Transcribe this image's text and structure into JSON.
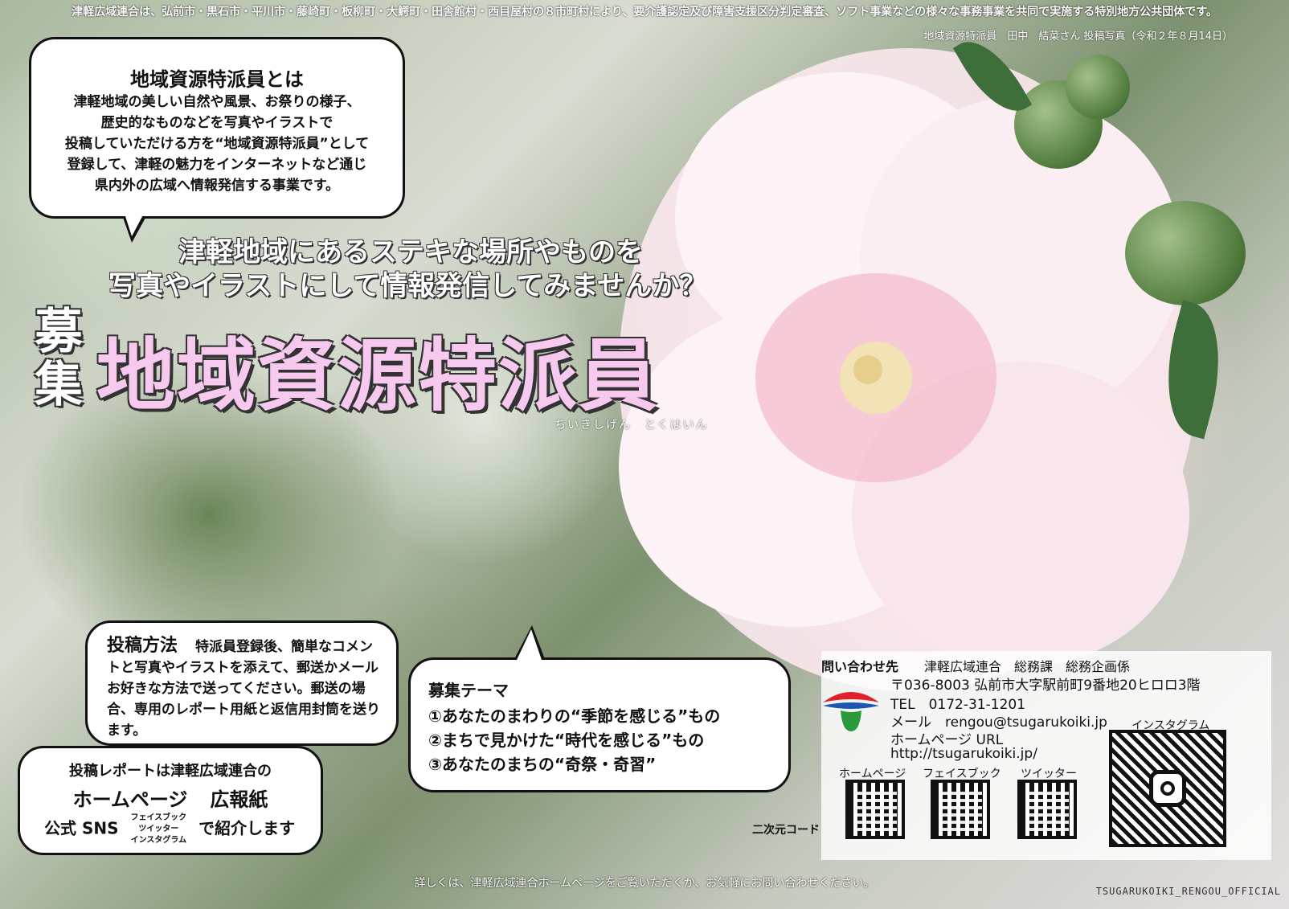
{
  "header": {
    "notice": "津軽広域連合は、弘前市・黒石市・平川市・藤崎町・板柳町・大鰐町・田舎館村・西目屋村の８市町村により、要介護認定及び障害支援区分判定審査、ソフト事業などの様々な事務事業を共同で実施する特別地方公共団体です。",
    "photo_credit": "地域資源特派員　田中　結菜さん 投稿写真（令和２年８月14日）"
  },
  "definition": {
    "title": "地域資源特派員とは",
    "lines": [
      "津軽地域の美しい自然や風景、お祭りの様子、",
      "歴史的なものなどを写真やイラストで",
      "投稿していただける方を“地域資源特派員”として",
      "登録して、津軽の魅力をインターネットなど通じ",
      "県内外の広域へ情報発信する事業です。"
    ]
  },
  "lead": {
    "line1": "津軽地域にあるステキな場所やものを",
    "line2": "写真やイラストにして情報発信してみませんか？"
  },
  "hero": {
    "boshu": [
      "募",
      "集"
    ],
    "title": "地域資源特派員",
    "ruby": "ちいきしげん　とくはいん"
  },
  "method": {
    "heading": "投稿方法",
    "text": "特派員登録後、簡単なコメントと写真やイラストを添えて、郵送かメールお好きな方法で送ってください。郵送の場合、専用のレポート用紙と返信用封筒を送ります。"
  },
  "report": {
    "line1": "投稿レポートは津軽広域連合の",
    "media": [
      "ホームページ",
      "広報紙"
    ],
    "sns_prefix": "公式 SNS",
    "sns_list": [
      "フェイスブック",
      "ツイッター",
      "インスタグラム"
    ],
    "suffix": "で紹介します"
  },
  "theme": {
    "title": "募集テーマ",
    "items": [
      "①あなたのまわりの“季節を感じる”もの",
      "②まちで見かけた“時代を感じる”もの",
      "③あなたのまちの“奇祭・奇習”"
    ]
  },
  "contact": {
    "label": "問い合わせ先",
    "org": "津軽広域連合　総務課　総務企画係",
    "address": "〒036-8003 弘前市大字駅前町9番地20ヒロロ3階",
    "tel": "TEL　0172-31-1201",
    "mail": "メール　rengou@tsugarukoiki.jp",
    "url_label": "ホームページ URL",
    "url": "http://tsugarukoiki.jp/",
    "qr_labels": [
      "ホームページ",
      "フェイスブック",
      "ツイッター",
      "インスタグラム"
    ],
    "qr_caption": "二次元コード"
  },
  "footer": {
    "note": "詳しくは、津軽広域連合ホームページをご覧いただくか、お気軽にお問い合わせください。",
    "handle": "TSUGARUKOIKI_RENGOU_OFFICIAL"
  },
  "colors": {
    "title_pink": "#f7c9ef",
    "logo_red": "#e0202a",
    "logo_blue": "#1d55b4",
    "logo_green": "#2a9a3c"
  }
}
